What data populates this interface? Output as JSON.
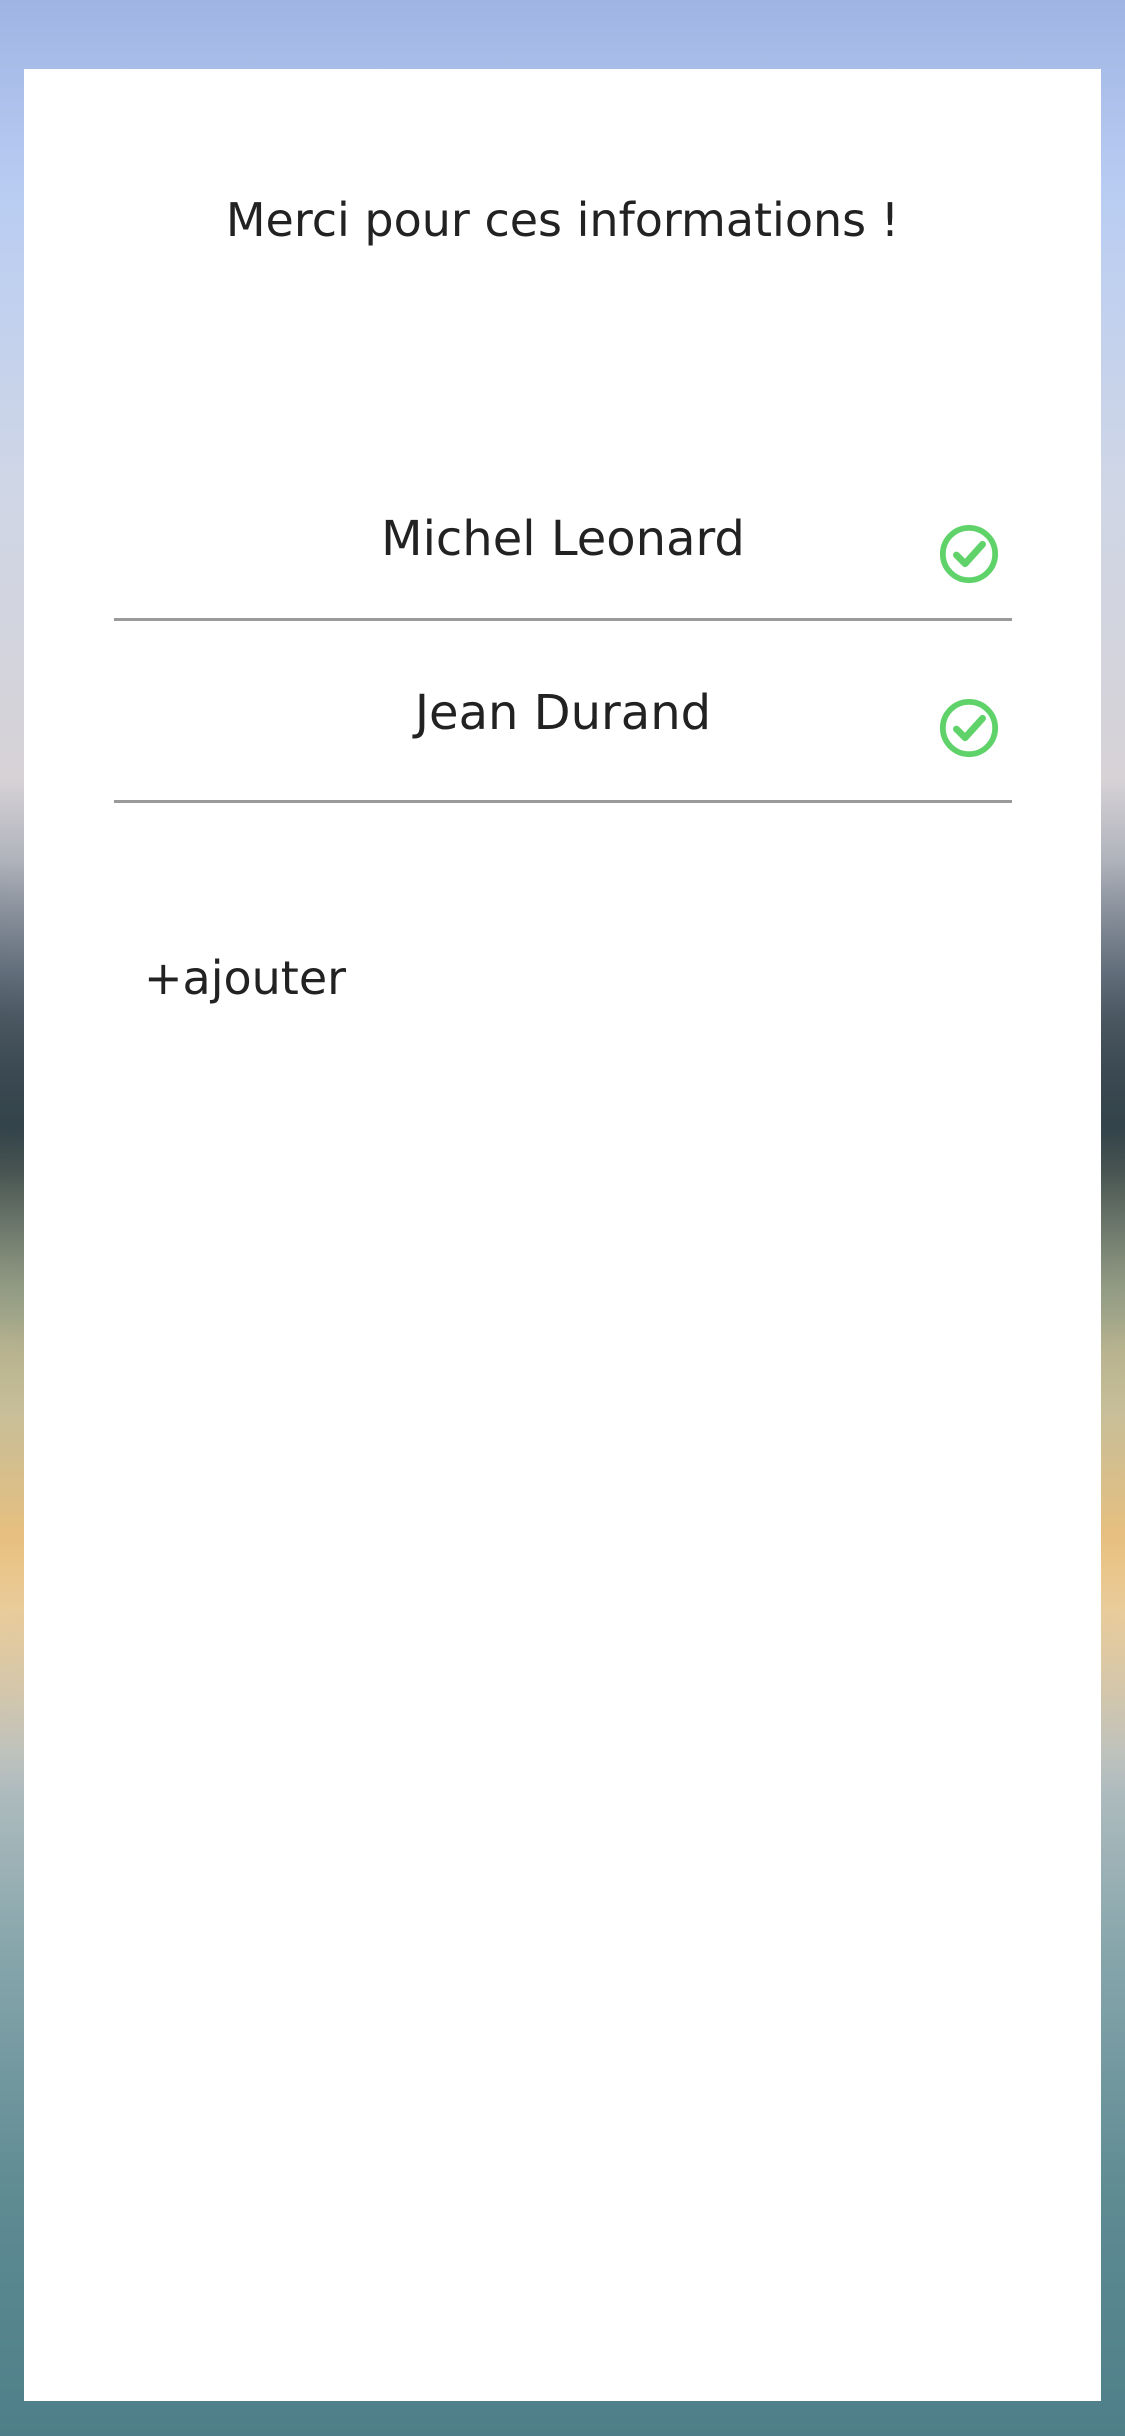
{
  "page": {
    "title": "Merci pour ces informations !"
  },
  "people": [
    {
      "name": "Michel Leonard",
      "status_icon": "check-circle-icon"
    },
    {
      "name": "Jean Durand",
      "status_icon": "check-circle-icon"
    }
  ],
  "actions": {
    "add_label": "+ajouter"
  },
  "colors": {
    "card": "#ffffff",
    "text": "#222222",
    "divider": "#9a9a9a",
    "check": "#5fd36a"
  }
}
